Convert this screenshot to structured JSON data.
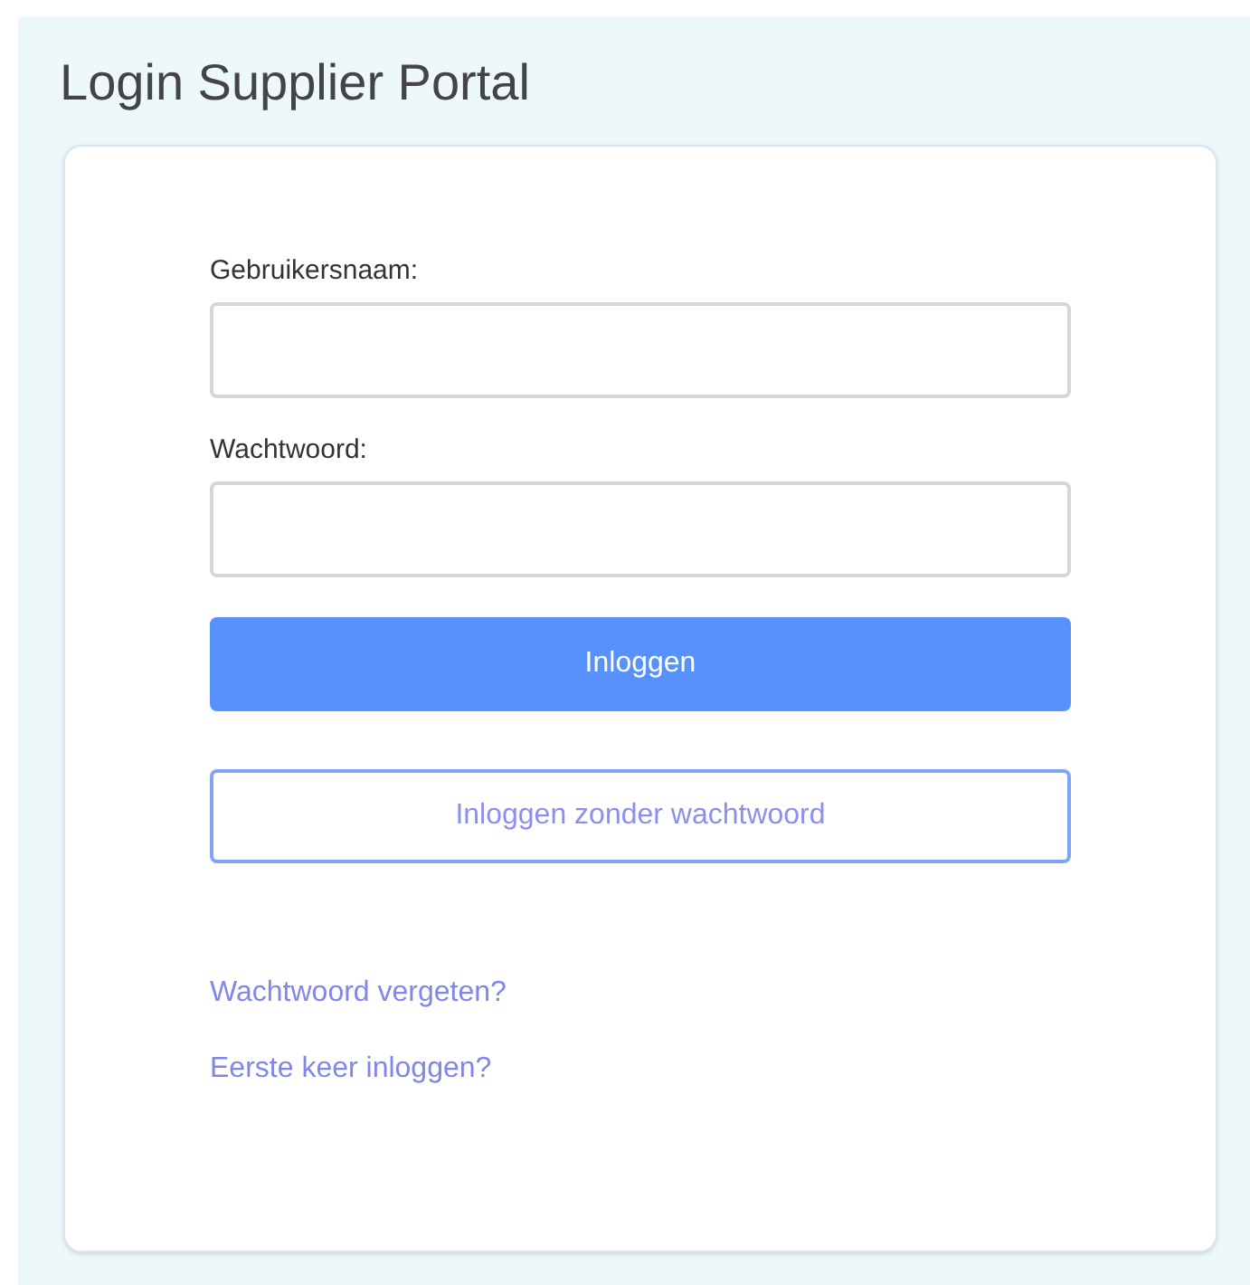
{
  "page": {
    "title": "Login Supplier Portal"
  },
  "fields": [
    {
      "label": "Gebruikersnaam:"
    },
    {
      "label": "Wachtwoord:"
    }
  ],
  "buttons": [
    {
      "label": "Inloggen",
      "kind": "primary"
    },
    {
      "label": "Inloggen zonder wachtwoord",
      "kind": "outline"
    }
  ],
  "links": [
    "Wachtwoord vergeten?",
    "Eerste keer inloggen?"
  ]
}
